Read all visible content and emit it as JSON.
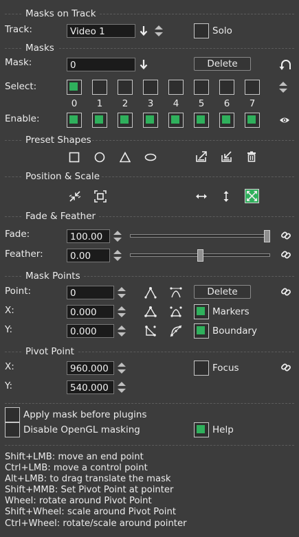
{
  "masks_on_track": {
    "title": "Masks on Track",
    "track_label": "Track:",
    "track_value": "Video 1",
    "solo_label": "Solo",
    "solo_checked": false
  },
  "masks": {
    "title": "Masks",
    "mask_label": "Mask:",
    "mask_value": "0",
    "delete_label": "Delete",
    "select_label": "Select:",
    "enable_label": "Enable:",
    "numbers": [
      "0",
      "1",
      "2",
      "3",
      "4",
      "5",
      "6",
      "7"
    ],
    "select_checked": [
      true,
      false,
      false,
      false,
      false,
      false,
      false,
      false
    ],
    "enable_checked": [
      true,
      true,
      true,
      true,
      true,
      true,
      true,
      true
    ]
  },
  "preset_shapes": {
    "title": "Preset Shapes"
  },
  "position_scale": {
    "title": "Position & Scale"
  },
  "fade_feather": {
    "title": "Fade & Feather",
    "fade_label": "Fade:",
    "fade_value": "100.00",
    "feather_label": "Feather:",
    "feather_value": "0.00",
    "fade_slider": 1.0,
    "feather_slider": 0.5
  },
  "mask_points": {
    "title": "Mask Points",
    "point_label": "Point:",
    "point_value": "0",
    "x_label": "X:",
    "x_value": "0.000",
    "y_label": "Y:",
    "y_value": "0.000",
    "delete_label": "Delete",
    "markers_label": "Markers",
    "markers_checked": true,
    "boundary_label": "Boundary",
    "boundary_checked": true
  },
  "pivot_point": {
    "title": "Pivot Point",
    "x_label": "X:",
    "x_value": "960.000",
    "y_label": "Y:",
    "y_value": "540.000",
    "focus_label": "Focus",
    "focus_checked": false
  },
  "options": {
    "apply_before_plugins": "Apply mask before plugins",
    "disable_opengl": "Disable OpenGL masking",
    "help_label": "Help",
    "help_checked": true
  },
  "help_text": [
    "Shift+LMB: move an end point",
    "Ctrl+LMB: move a control point",
    "Alt+LMB: to drag translate the mask",
    "Shift+MMB: Set Pivot Point at pointer",
    "Wheel: rotate around Pivot Point",
    "Shift+Wheel: scale around Pivot Point",
    "Ctrl+Wheel: rotate/scale around pointer"
  ],
  "colors": {
    "background": "#3c3c3c",
    "check_green": "#2fb05c",
    "text": "#ececec"
  }
}
